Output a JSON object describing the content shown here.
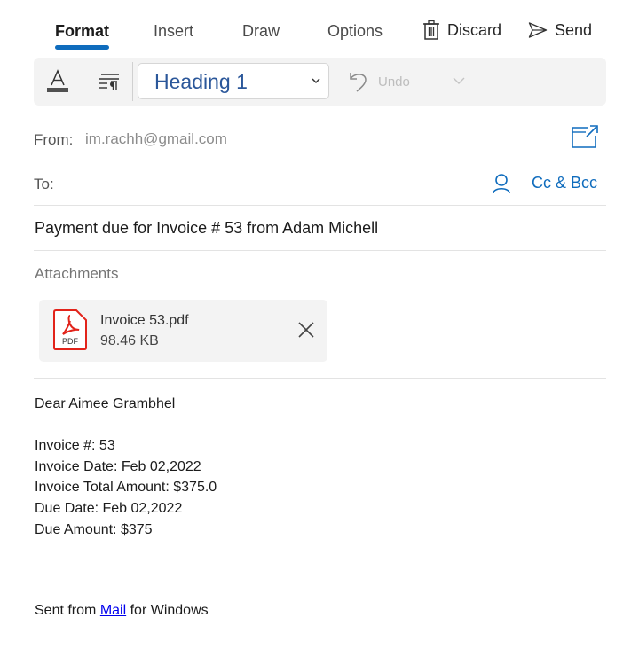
{
  "tabs": [
    {
      "label": "Format",
      "active": true
    },
    {
      "label": "Insert",
      "active": false
    },
    {
      "label": "Draw",
      "active": false
    },
    {
      "label": "Options",
      "active": false
    }
  ],
  "actions": {
    "discard_label": "Discard",
    "send_label": "Send"
  },
  "toolbar": {
    "font_color_icon": "font-color-icon",
    "paragraph_icon": "paragraph-format-icon",
    "style_value": "Heading 1",
    "undo_label": "Undo"
  },
  "header": {
    "from_label": "From:",
    "from_value": "im.rachh@gmail.com",
    "to_label": "To:",
    "to_value": "",
    "cc_bcc_label": "Cc & Bcc",
    "subject": "Payment due for Invoice # 53 from Adam Michell"
  },
  "attachments": {
    "title": "Attachments",
    "items": [
      {
        "name": "Invoice 53.pdf",
        "size": "98.46 KB",
        "icon_text": "PDF"
      }
    ]
  },
  "body": {
    "greeting": "Dear Aimee Grambhel",
    "lines": [
      "Invoice #: 53",
      "Invoice Date: Feb 02,2022",
      "Invoice Total Amount: $375.0",
      "Due Date: Feb 02,2022",
      "Due Amount: $375"
    ],
    "signature_prefix": "Sent from ",
    "signature_link": "Mail",
    "signature_suffix": " for Windows"
  },
  "colors": {
    "accent": "#0f6cbd",
    "style_text": "#2b579a",
    "pdf_red": "#e2231a",
    "link": "#0000ee"
  }
}
